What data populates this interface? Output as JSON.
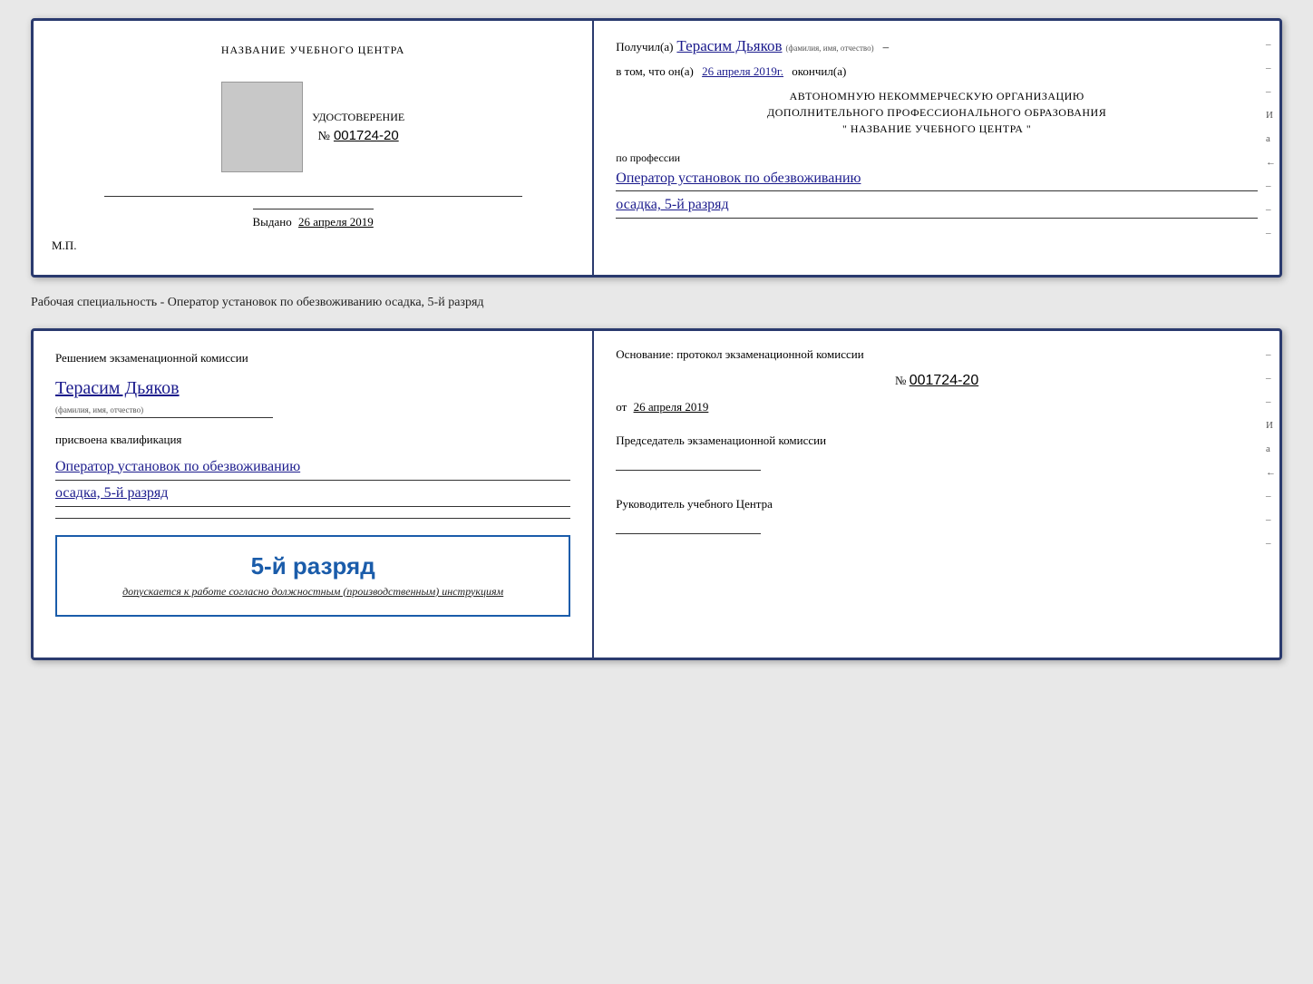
{
  "top_card": {
    "left": {
      "title": "НАЗВАНИЕ УЧЕБНОГО ЦЕНТРА",
      "cert_label": "УДОСТОВЕРЕНИЕ",
      "cert_no_prefix": "№",
      "cert_no": "001724-20",
      "issued_label": "Выдано",
      "issued_date": "26 апреля 2019",
      "mp": "М.П."
    },
    "right": {
      "received_prefix": "Получил(а)",
      "recipient_name": "Терасим Дьяков",
      "name_sublabel": "(фамилия, имя, отчество)",
      "date_prefix": "в том, что он(а)",
      "date_value": "26 апреля 2019г.",
      "date_suffix": "окончил(а)",
      "org_line1": "АВТОНОМНУЮ НЕКОММЕРЧЕСКУЮ ОРГАНИЗАЦИЮ",
      "org_line2": "ДОПОЛНИТЕЛЬНОГО ПРОФЕССИОНАЛЬНОГО ОБРАЗОВАНИЯ",
      "org_line3": "\" НАЗВАНИЕ УЧЕБНОГО ЦЕНТРА \"",
      "profession_label": "по профессии",
      "profession_line1": "Оператор установок по обезвоживанию",
      "profession_line2": "осадка, 5-й разряд",
      "side_marks": [
        "-",
        "-",
        "-",
        "И",
        "а",
        "←",
        "-",
        "-",
        "-",
        "-"
      ]
    }
  },
  "specialty_label": "Рабочая специальность - Оператор установок по обезвоживанию осадка, 5-й разряд",
  "bottom_card": {
    "left": {
      "title_line1": "Решением экзаменационной комиссии",
      "person_name": "Терасим Дьяков",
      "name_sublabel": "(фамилия, имя, отчество)",
      "assigned_label": "присвоена квалификация",
      "qual_line1": "Оператор установок по обезвоживанию",
      "qual_line2": "осадка, 5-й разряд",
      "stamp_rank": "5-й разряд",
      "stamp_text": "допускается к работе согласно должностным (производственным) инструкциям"
    },
    "right": {
      "basis_label": "Основание: протокол экзаменационной комиссии",
      "protocol_no_prefix": "№",
      "protocol_no": "001724-20",
      "date_prefix": "от",
      "date_value": "26 апреля 2019",
      "chairman_title": "Председатель экзаменационной комиссии",
      "director_title": "Руководитель учебного Центра",
      "side_marks": [
        "-",
        "-",
        "-",
        "И",
        "а",
        "←",
        "-",
        "-",
        "-",
        "-"
      ]
    }
  }
}
